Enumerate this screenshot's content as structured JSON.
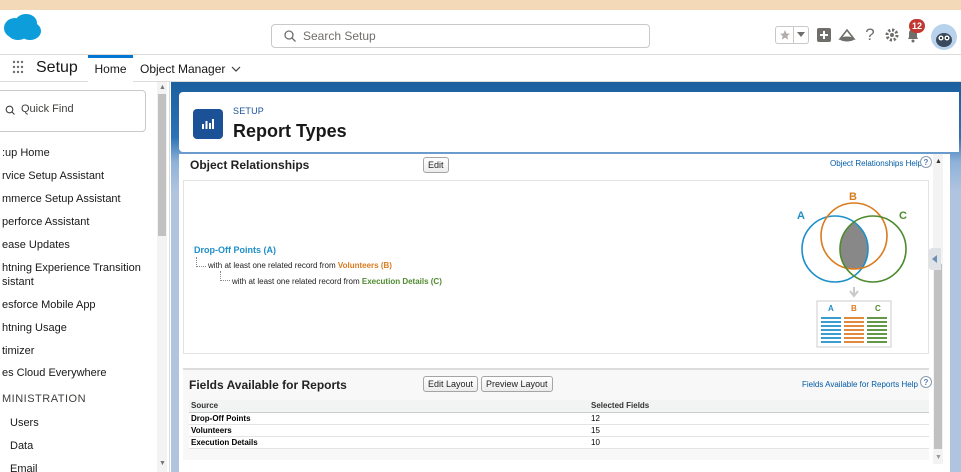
{
  "header": {
    "search_placeholder": "Search Setup",
    "notification_count": "12",
    "icons": [
      "salesforce-cloud-icon",
      "search-icon",
      "star-icon",
      "chevron-down-icon",
      "plus-icon",
      "trailhead-icon",
      "help-icon",
      "gear-icon",
      "bell-icon",
      "avatar"
    ]
  },
  "nav": {
    "app_title": "Setup",
    "tabs": [
      {
        "label": "Home"
      },
      {
        "label": "Object Manager"
      }
    ]
  },
  "sidebar": {
    "quick_find_placeholder": "Quick Find",
    "items": [
      {
        "label": ":up Home"
      },
      {
        "label": "rvice Setup Assistant"
      },
      {
        "label": "mmerce Setup Assistant"
      },
      {
        "label": "perforce Assistant"
      },
      {
        "label": "ease Updates"
      },
      {
        "label": "htning Experience Transition"
      },
      {
        "label": "sistant"
      },
      {
        "label": "esforce Mobile App"
      },
      {
        "label": "htning Usage"
      },
      {
        "label": "timizer"
      },
      {
        "label": "es Cloud Everywhere"
      },
      {
        "label": "MINISTRATION"
      },
      {
        "label": "Users"
      },
      {
        "label": "Data"
      },
      {
        "label": "Email"
      }
    ]
  },
  "page": {
    "subtitle": "SETUP",
    "title": "Report Types"
  },
  "relationships": {
    "heading": "Object Relationships",
    "edit_label": "Edit",
    "help_label": "Object Relationships Help",
    "help_q": "?",
    "primary": "Drop-Off Points (A)",
    "line_prefix": "with at least one related record from",
    "b_object": "Volunteers (B)",
    "c_object": "Execution Details (C)",
    "venn": {
      "a": "A",
      "b": "B",
      "c": "C"
    },
    "colors": {
      "a": "#1e8fc9",
      "b": "#d97b1f",
      "c": "#4e8a2e"
    }
  },
  "fields": {
    "heading": "Fields Available for Reports",
    "edit_layout_label": "Edit Layout",
    "preview_layout_label": "Preview Layout",
    "help_label": "Fields Available for Reports Help",
    "help_q": "?",
    "columns": [
      "Source",
      "Selected Fields"
    ],
    "rows": [
      {
        "source": "Drop-Off Points",
        "count": "12"
      },
      {
        "source": "Volunteers",
        "count": "15"
      },
      {
        "source": "Execution Details",
        "count": "10"
      }
    ]
  }
}
